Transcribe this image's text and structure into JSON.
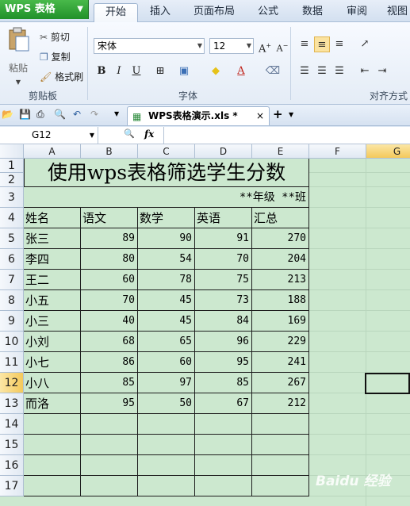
{
  "app": {
    "menu_button": "WPS 表格",
    "tabs": [
      "开始",
      "插入",
      "页面布局",
      "公式",
      "数据",
      "审阅",
      "视图"
    ],
    "active_tab": "开始"
  },
  "ribbon": {
    "clipboard": {
      "paste": "粘贴",
      "cut": "剪切",
      "copy": "复制",
      "format_painter": "格式刷",
      "label": "剪贴板"
    },
    "font": {
      "name": "宋体",
      "size": "12",
      "bold": "B",
      "italic": "I",
      "underline": "U",
      "label": "字体"
    },
    "alignment": {
      "label": "对齐方式"
    }
  },
  "document": {
    "tab_title": "WPS表格演示.xls *"
  },
  "formula_bar": {
    "name_box": "G12",
    "fx": "fx"
  },
  "sheet": {
    "columns": [
      "A",
      "B",
      "C",
      "D",
      "E",
      "F",
      "G"
    ],
    "selected_column": "G",
    "rows": [
      "1",
      "2",
      "3",
      "4",
      "5",
      "6",
      "7",
      "8",
      "9",
      "10",
      "11",
      "12",
      "13",
      "14",
      "15",
      "16",
      "17"
    ],
    "selected_row": "12",
    "title": "使用wps表格筛选学生分数",
    "class_line": "**年级 **班",
    "headers": [
      "姓名",
      "语文",
      "数学",
      "英语",
      "汇总"
    ],
    "records": [
      [
        "张三",
        "89",
        "90",
        "91",
        "270"
      ],
      [
        "李四",
        "80",
        "54",
        "70",
        "204"
      ],
      [
        "王二",
        "60",
        "78",
        "75",
        "213"
      ],
      [
        "小五",
        "70",
        "45",
        "73",
        "188"
      ],
      [
        "小三",
        "40",
        "45",
        "84",
        "169"
      ],
      [
        "小刘",
        "68",
        "65",
        "96",
        "229"
      ],
      [
        "小七",
        "86",
        "60",
        "95",
        "241"
      ],
      [
        "小八",
        "85",
        "97",
        "85",
        "267"
      ],
      [
        "而洛",
        "95",
        "50",
        "67",
        "212"
      ]
    ]
  },
  "watermark": "Baidu 经验",
  "colors": {
    "sheet_bg": "#cce8cf",
    "menu_green": "#21912a",
    "selection": "#f4c95b"
  }
}
